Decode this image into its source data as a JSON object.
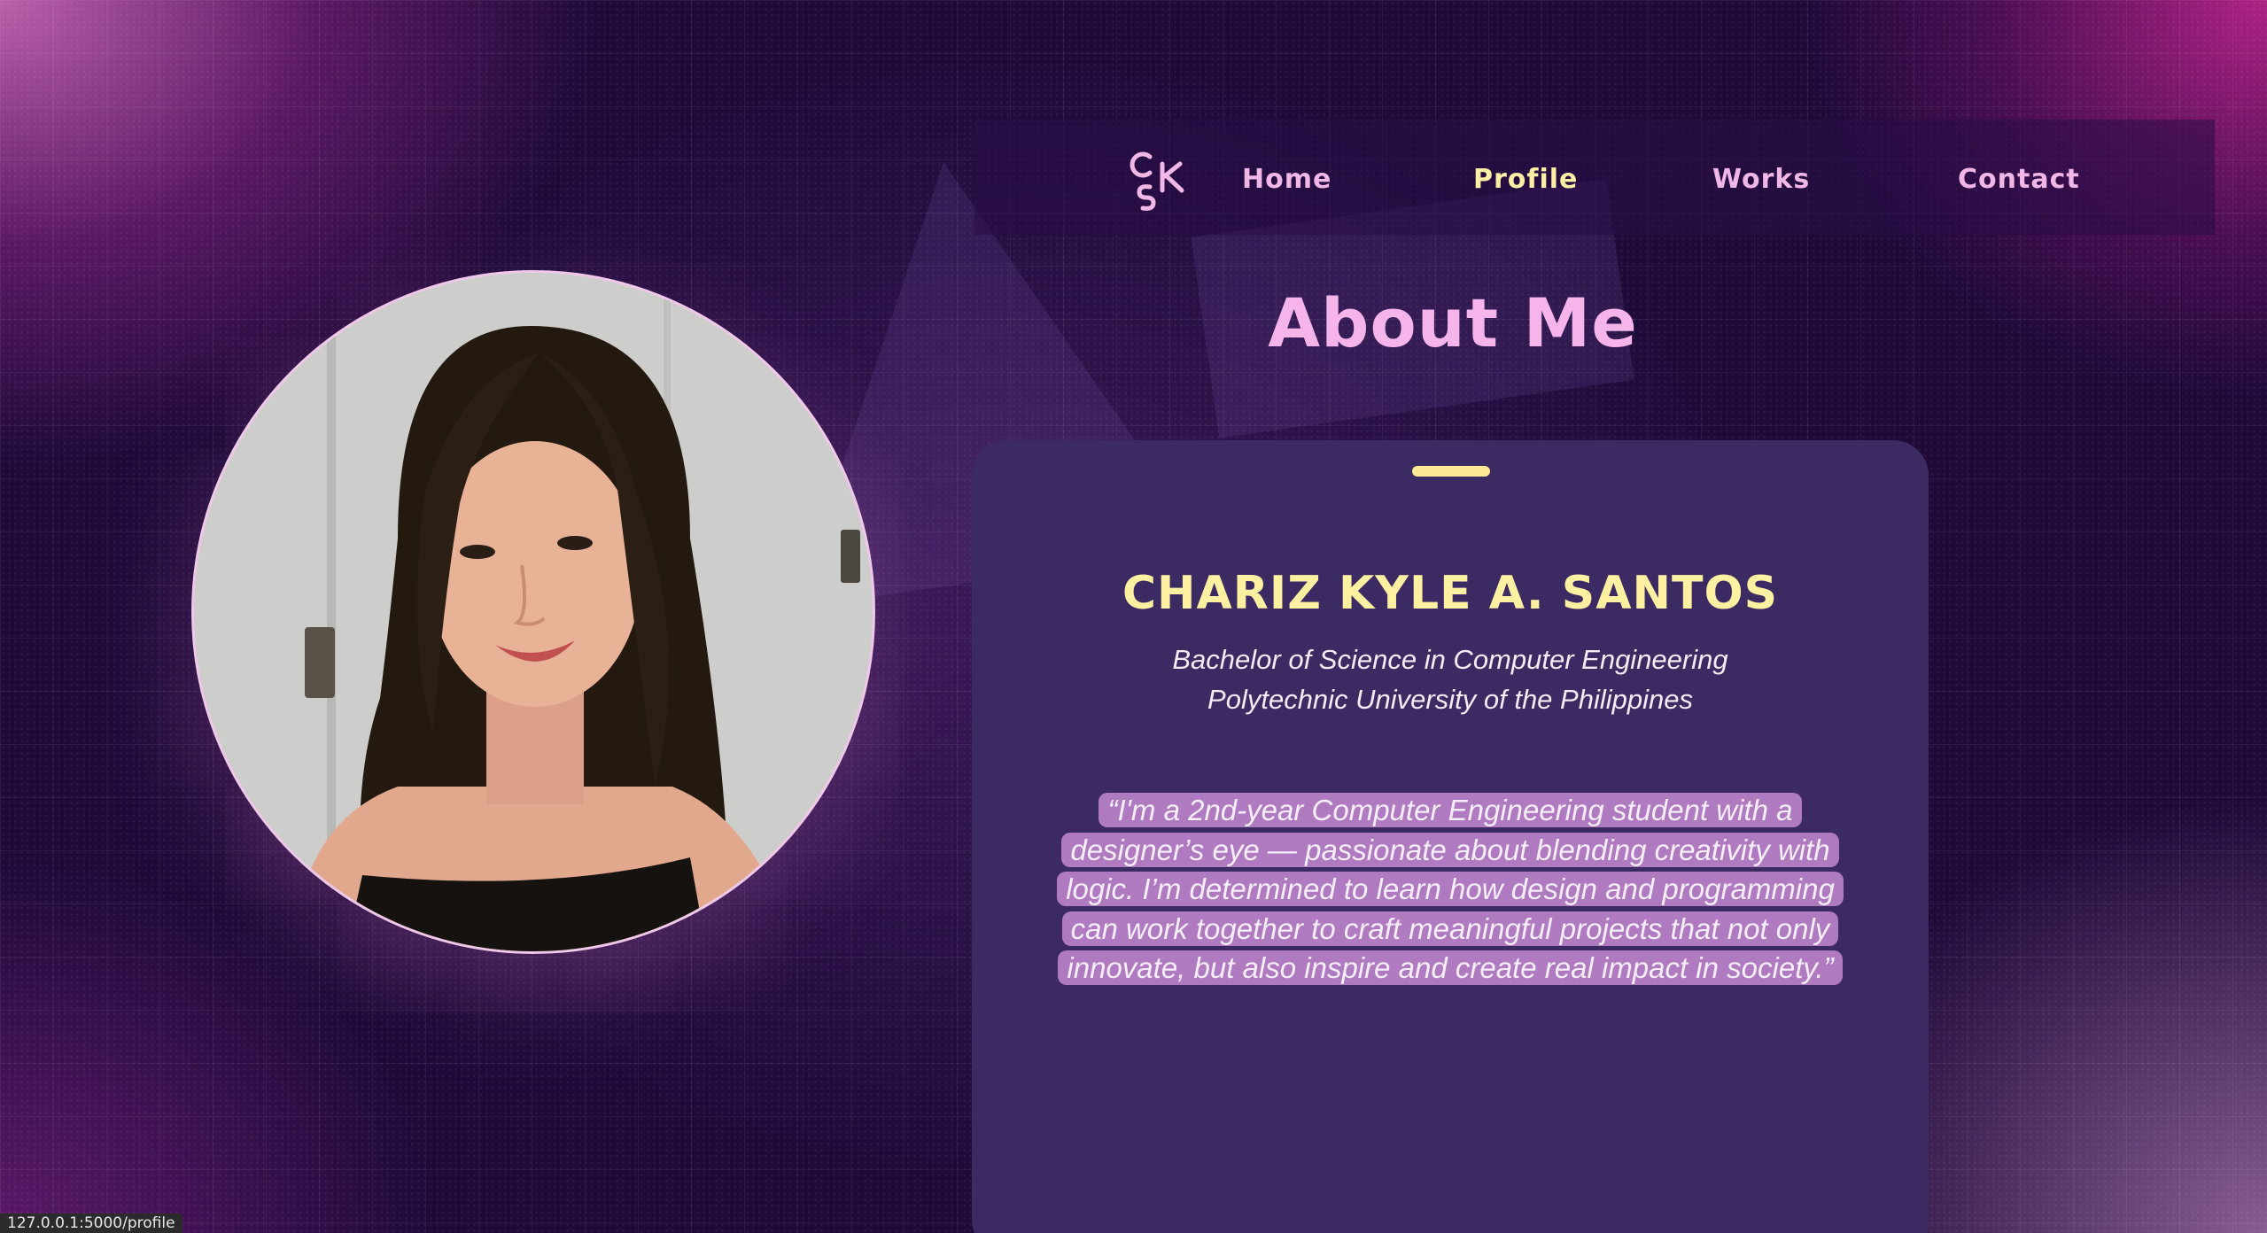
{
  "nav": {
    "logo_text": "CSK",
    "links": [
      {
        "label": "Home",
        "active": false
      },
      {
        "label": "Profile",
        "active": true
      },
      {
        "label": "Works",
        "active": false
      },
      {
        "label": "Contact",
        "active": false
      }
    ]
  },
  "about": {
    "title": "About Me"
  },
  "profile": {
    "name": "CHARIZ KYLE A. SANTOS",
    "degree": "Bachelor of Science in Computer Engineering",
    "school": "Polytechnic University of the Philippines",
    "quote": "“I'm a 2nd-year Computer Engineering student with a designer’s eye — passionate about blending creativity with logic. I’m determined to learn how design and programming can work together to craft meaningful projects that not only innovate, but also inspire and create real impact in society.”"
  },
  "statusbar": {
    "url": "127.0.0.1:5000/profile"
  },
  "colors": {
    "accent_yellow": "#fff0a2",
    "accent_pink": "#f5b5ea",
    "card_bg": "#3c2a62",
    "quote_highlight": "#b07ac0"
  }
}
